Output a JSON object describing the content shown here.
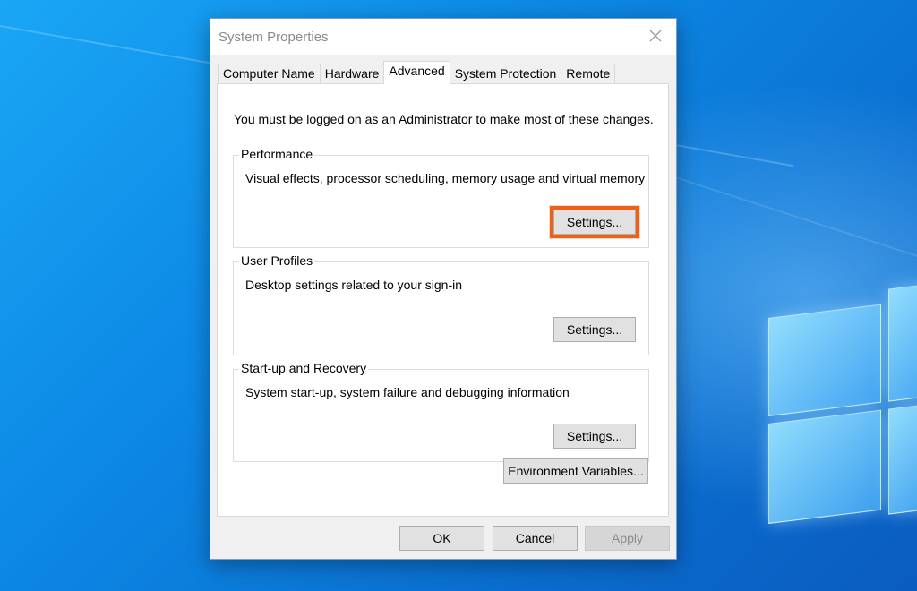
{
  "window": {
    "title": "System Properties",
    "close_icon": "close-icon"
  },
  "tabs": [
    {
      "label": "Computer Name",
      "active": false
    },
    {
      "label": "Hardware",
      "active": false
    },
    {
      "label": "Advanced",
      "active": true
    },
    {
      "label": "System Protection",
      "active": false
    },
    {
      "label": "Remote",
      "active": false
    }
  ],
  "advanced": {
    "note": "You must be logged on as an Administrator to make most of these changes.",
    "performance": {
      "label": "Performance",
      "description": "Visual effects, processor scheduling, memory usage and virtual memory",
      "button": "Settings..."
    },
    "user_profiles": {
      "label": "User Profiles",
      "description": "Desktop settings related to your sign-in",
      "button": "Settings..."
    },
    "startup_recovery": {
      "label": "Start-up and Recovery",
      "description": "System start-up, system failure and debugging information",
      "button": "Settings..."
    },
    "env_button": "Environment Variables..."
  },
  "footer": {
    "ok": "OK",
    "cancel": "Cancel",
    "apply": "Apply"
  },
  "colors": {
    "highlight": "#ef5f16",
    "desktop": "#0a78d7"
  }
}
